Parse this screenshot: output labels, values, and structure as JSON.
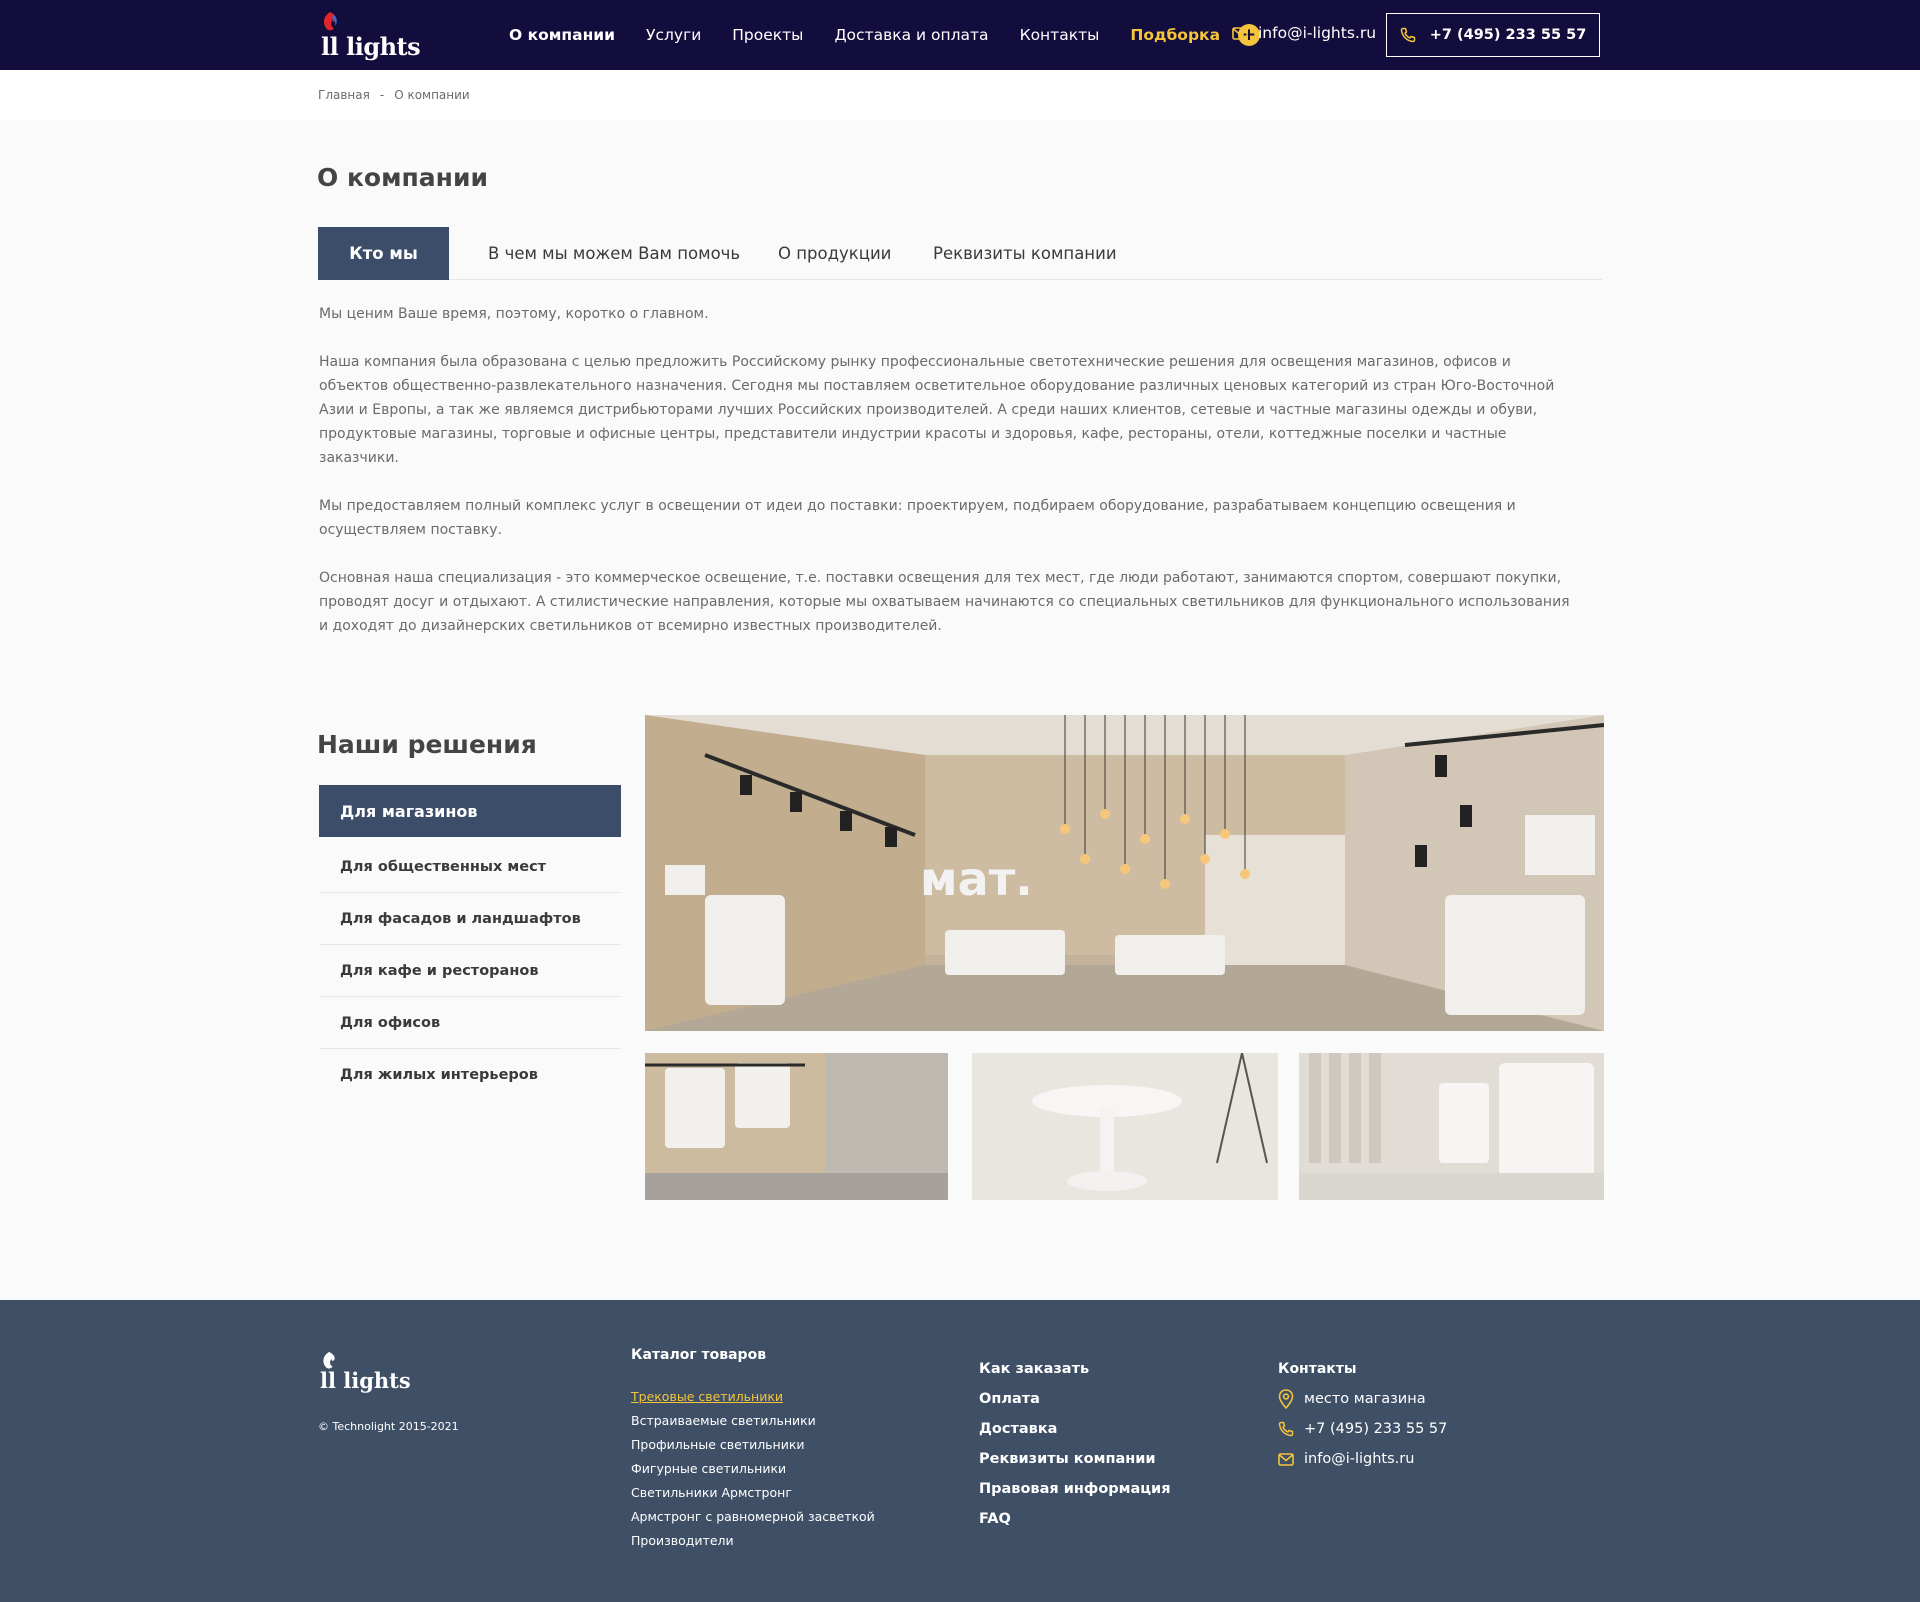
{
  "header": {
    "logo_text": "ll lights",
    "nav": [
      {
        "label": "О компании",
        "active": true
      },
      {
        "label": "Услуги"
      },
      {
        "label": "Проекты"
      },
      {
        "label": "Доставка и оплата"
      },
      {
        "label": "Контакты"
      }
    ],
    "highlight_label": "Подборка",
    "plus_symbol": "+",
    "email": "info@i-lights.ru",
    "phone": "+7 (495)  233 55 57"
  },
  "breadcrumb": {
    "home": "Главная",
    "separator": "-",
    "current": "О компании"
  },
  "about": {
    "title": "О компании",
    "tabs": [
      {
        "label": "Кто мы",
        "active": true
      },
      {
        "label": "В чем мы можем Вам помочь"
      },
      {
        "label": "О продукции"
      },
      {
        "label": "Реквизиты компании"
      }
    ],
    "paragraphs": [
      "Мы ценим Ваше время, поэтому, коротко о главном.",
      "Наша компания была образована с целью предложить Российскому рынку профессиональные светотехнические решения для освещения магазинов, офисов и объектов общественно-развлекательного назначения. Сегодня мы поставляем осветительное оборудование различных ценовых категорий из стран Юго-Восточной Азии и Европы, а так же являемся дистрибьюторами лучших Российских производителей. А среди наших клиентов, сетевые и частные магазины одежды и обуви, продуктовые магазины, торговые и офисные центры, представители индустрии красоты и здоровья, кафе, рестораны, отели, коттеджные поселки и частные заказчики.",
      "Мы предоставляем полный комплекс услуг в освещении от идеи до поставки: проектируем, подбираем оборудование, разрабатываем концепцию освещения и осуществляем поставку.",
      "Основная наша специализация - это коммерческое освещение, т.е. поставки освещения для тех мест, где люди работают, занимаются спортом, совершают покупки, проводят досуг и отдыхают. А стилистические направления, которые мы охватываем начинаются со специальных светильников для функционального использования и доходят до дизайнерских светильников от всемирно известных производителей."
    ]
  },
  "solutions": {
    "title": "Наши решения",
    "items": [
      {
        "label": "Для магазинов",
        "active": true
      },
      {
        "label": "Для общественных мест"
      },
      {
        "label": "Для фасадов и ландшафтов"
      },
      {
        "label": "Для кафе и ресторанов"
      },
      {
        "label": "Для офисов"
      },
      {
        "label": "Для жилых интерьеров"
      }
    ],
    "main_photo_sign": "мат."
  },
  "footer": {
    "logo_text": "ll lights",
    "copyright": "© Technolight 2015-2021",
    "catalog": {
      "title": "Каталог товаров",
      "links": [
        "Трековые светильники",
        "Встраиваемые светильники",
        "Профильные светильники",
        "Фигурные светильники",
        "Светильники Армстронг",
        "Армстронг с равномерной засветкой",
        "Производители"
      ]
    },
    "order_links": [
      "Как заказать",
      "Оплата",
      "Доставка",
      "Реквизиты компании",
      "Правовая информация",
      "FAQ"
    ],
    "contacts": {
      "title": "Контакты",
      "location": "место магазина",
      "phone": "+7 (495) 233 55 57",
      "email": "info@i-lights.ru"
    }
  },
  "colors": {
    "header_bg": "#130d3d",
    "accent": "#f5c43a",
    "active_bg": "#3b4d68",
    "footer_bg": "#3e4f66"
  }
}
